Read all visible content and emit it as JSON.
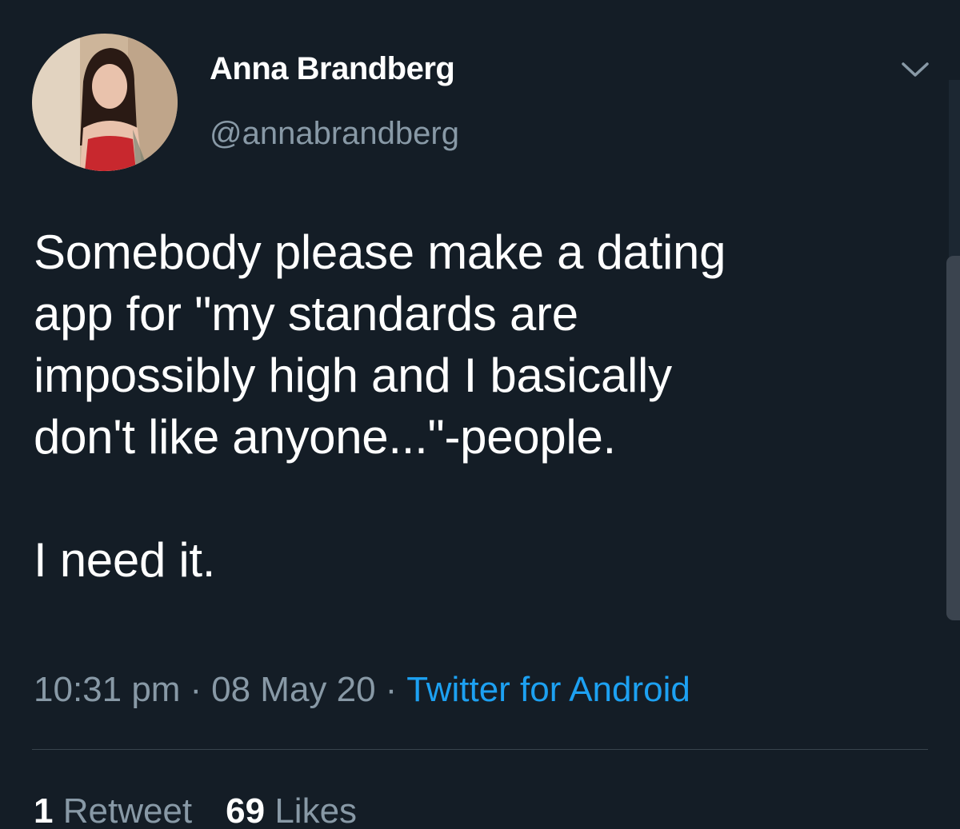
{
  "author": {
    "name": "Anna Brandberg",
    "handle": "@annabrandberg",
    "avatar_icon": "profile-photo"
  },
  "tweet": {
    "lines": [
      "Somebody please make a dating",
      "app for \"my standards are",
      "impossibly high and I basically",
      "don't like anyone...\"-people."
    ],
    "last_line": "I need it."
  },
  "meta": {
    "time": "10:31 pm",
    "separator": "·",
    "date": "08 May 20",
    "source": "Twitter for Android"
  },
  "stats": {
    "retweets_count": "1",
    "retweets_label": "Retweet",
    "likes_count": "69",
    "likes_label": "Likes"
  },
  "colors": {
    "background": "#141d26",
    "secondary_text": "#8899a6",
    "link": "#1da1f2",
    "divider": "#38444d"
  },
  "icons": {
    "menu": "chevron-down-icon"
  }
}
